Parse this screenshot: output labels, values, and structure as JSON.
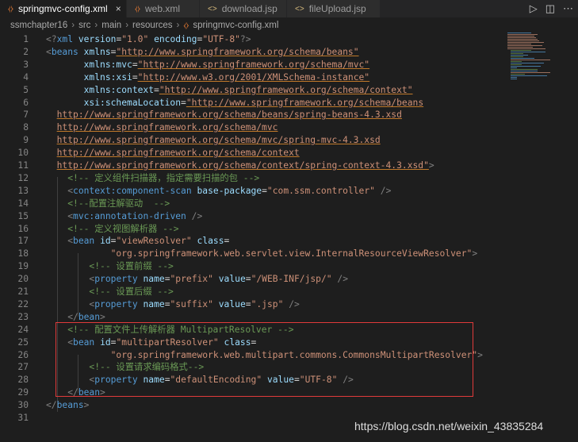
{
  "tabs": [
    {
      "label": "springmvc-config.xml",
      "active": true,
      "close": "×"
    },
    {
      "label": "web.xml",
      "active": false
    },
    {
      "label": "download.jsp",
      "active": false
    },
    {
      "label": "fileUpload.jsp",
      "active": false
    }
  ],
  "breadcrumb": [
    "ssmchapter16",
    "src",
    "main",
    "resources",
    "springmvc-config.xml"
  ],
  "actions": {
    "run": "▷",
    "split": "◫",
    "more": "⋯"
  },
  "lines": [
    {
      "n": "1",
      "segs": [
        [
          "pu",
          "<?"
        ],
        [
          "tg",
          "xml"
        ],
        [
          "tx",
          " "
        ],
        [
          "at",
          "version"
        ],
        [
          "tx",
          "="
        ],
        [
          "st",
          "\"1.0\""
        ],
        [
          "tx",
          " "
        ],
        [
          "at",
          "encoding"
        ],
        [
          "tx",
          "="
        ],
        [
          "st",
          "\"UTF-8\""
        ],
        [
          "pu",
          "?>"
        ]
      ]
    },
    {
      "n": "2",
      "segs": [
        [
          "pu",
          "<"
        ],
        [
          "tg",
          "beans"
        ],
        [
          "tx",
          " "
        ],
        [
          "at",
          "xmlns"
        ],
        [
          "tx",
          "="
        ],
        [
          "st",
          "\"http://www.springframework.org/schema/beans\""
        ]
      ]
    },
    {
      "n": "3",
      "segs": [
        [
          "tx",
          "       "
        ],
        [
          "at",
          "xmlns:mvc"
        ],
        [
          "tx",
          "="
        ],
        [
          "st",
          "\"http://www.springframework.org/schema/mvc\""
        ]
      ]
    },
    {
      "n": "4",
      "segs": [
        [
          "tx",
          "       "
        ],
        [
          "at",
          "xmlns:xsi"
        ],
        [
          "tx",
          "="
        ],
        [
          "st",
          "\"http://www.w3.org/2001/XMLSchema-instance\""
        ]
      ]
    },
    {
      "n": "5",
      "segs": [
        [
          "tx",
          "       "
        ],
        [
          "at",
          "xmlns:context"
        ],
        [
          "tx",
          "="
        ],
        [
          "st",
          "\"http://www.springframework.org/schema/context\""
        ]
      ]
    },
    {
      "n": "6",
      "segs": [
        [
          "tx",
          "       "
        ],
        [
          "at",
          "xsi:schemaLocation"
        ],
        [
          "tx",
          "="
        ],
        [
          "st",
          "\"http://www.springframework.org/schema/beans"
        ]
      ]
    },
    {
      "n": "7",
      "segs": [
        [
          "tx",
          "  "
        ],
        [
          "st",
          "http://www.springframework.org/schema/beans/spring-beans-4.3.xsd"
        ]
      ]
    },
    {
      "n": "8",
      "segs": [
        [
          "tx",
          "  "
        ],
        [
          "st",
          "http://www.springframework.org/schema/mvc"
        ]
      ]
    },
    {
      "n": "9",
      "segs": [
        [
          "tx",
          "  "
        ],
        [
          "st",
          "http://www.springframework.org/schema/mvc/spring-mvc-4.3.xsd"
        ]
      ]
    },
    {
      "n": "10",
      "segs": [
        [
          "tx",
          "  "
        ],
        [
          "st",
          "http://www.springframework.org/schema/context"
        ]
      ]
    },
    {
      "n": "11",
      "segs": [
        [
          "tx",
          "  "
        ],
        [
          "st",
          "http://www.springframework.org/schema/context/spring-context-4.3.xsd\""
        ],
        [
          "pu",
          ">"
        ]
      ]
    },
    {
      "n": "12",
      "segs": [
        [
          "tx",
          "    "
        ],
        [
          "cm",
          "<!-- 定义组件扫描器，指定需要扫描的包 -->"
        ]
      ]
    },
    {
      "n": "13",
      "segs": [
        [
          "tx",
          "    "
        ],
        [
          "pu",
          "<"
        ],
        [
          "tg",
          "context:component-scan"
        ],
        [
          "tx",
          " "
        ],
        [
          "at",
          "base-package"
        ],
        [
          "tx",
          "="
        ],
        [
          "st",
          "\"com.ssm.controller\""
        ],
        [
          "tx",
          " "
        ],
        [
          "pu",
          "/>"
        ]
      ]
    },
    {
      "n": "14",
      "segs": [
        [
          "tx",
          "    "
        ],
        [
          "cm",
          "<!--配置注解驱动  -->"
        ]
      ]
    },
    {
      "n": "15",
      "segs": [
        [
          "tx",
          "    "
        ],
        [
          "pu",
          "<"
        ],
        [
          "tg",
          "mvc:annotation-driven"
        ],
        [
          "tx",
          " "
        ],
        [
          "pu",
          "/>"
        ]
      ]
    },
    {
      "n": "16",
      "segs": [
        [
          "tx",
          "    "
        ],
        [
          "cm",
          "<!-- 定义视图解析器 -->"
        ]
      ]
    },
    {
      "n": "17",
      "segs": [
        [
          "tx",
          "    "
        ],
        [
          "pu",
          "<"
        ],
        [
          "tg",
          "bean"
        ],
        [
          "tx",
          " "
        ],
        [
          "at",
          "id"
        ],
        [
          "tx",
          "="
        ],
        [
          "st",
          "\"viewResolver\""
        ],
        [
          "tx",
          " "
        ],
        [
          "at",
          "class"
        ],
        [
          "tx",
          "="
        ]
      ]
    },
    {
      "n": "18",
      "segs": [
        [
          "tx",
          "            "
        ],
        [
          "st",
          "\"org.springframework.web.servlet.view.InternalResourceViewResolver\""
        ],
        [
          "pu",
          ">"
        ]
      ]
    },
    {
      "n": "19",
      "segs": [
        [
          "tx",
          "        "
        ],
        [
          "cm",
          "<!-- 设置前缀 -->"
        ]
      ]
    },
    {
      "n": "20",
      "segs": [
        [
          "tx",
          "        "
        ],
        [
          "pu",
          "<"
        ],
        [
          "tg",
          "property"
        ],
        [
          "tx",
          " "
        ],
        [
          "at",
          "name"
        ],
        [
          "tx",
          "="
        ],
        [
          "st",
          "\"prefix\""
        ],
        [
          "tx",
          " "
        ],
        [
          "at",
          "value"
        ],
        [
          "tx",
          "="
        ],
        [
          "st",
          "\"/WEB-INF/jsp/\""
        ],
        [
          "tx",
          " "
        ],
        [
          "pu",
          "/>"
        ]
      ]
    },
    {
      "n": "21",
      "segs": [
        [
          "tx",
          "        "
        ],
        [
          "cm",
          "<!-- 设置后缀 -->"
        ]
      ]
    },
    {
      "n": "22",
      "segs": [
        [
          "tx",
          "        "
        ],
        [
          "pu",
          "<"
        ],
        [
          "tg",
          "property"
        ],
        [
          "tx",
          " "
        ],
        [
          "at",
          "name"
        ],
        [
          "tx",
          "="
        ],
        [
          "st",
          "\"suffix\""
        ],
        [
          "tx",
          " "
        ],
        [
          "at",
          "value"
        ],
        [
          "tx",
          "="
        ],
        [
          "st",
          "\".jsp\""
        ],
        [
          "tx",
          " "
        ],
        [
          "pu",
          "/>"
        ]
      ]
    },
    {
      "n": "23",
      "segs": [
        [
          "tx",
          "    "
        ],
        [
          "pu",
          "</"
        ],
        [
          "tg",
          "bean"
        ],
        [
          "pu",
          ">"
        ]
      ]
    },
    {
      "n": "24",
      "segs": [
        [
          "tx",
          "    "
        ],
        [
          "cm",
          "<!-- 配置文件上传解析器 MultipartResolver -->"
        ]
      ]
    },
    {
      "n": "25",
      "segs": [
        [
          "tx",
          "    "
        ],
        [
          "pu",
          "<"
        ],
        [
          "tg",
          "bean"
        ],
        [
          "tx",
          " "
        ],
        [
          "at",
          "id"
        ],
        [
          "tx",
          "="
        ],
        [
          "st",
          "\"multipartResolver\""
        ],
        [
          "tx",
          " "
        ],
        [
          "at",
          "class"
        ],
        [
          "tx",
          "="
        ]
      ]
    },
    {
      "n": "26",
      "segs": [
        [
          "tx",
          "            "
        ],
        [
          "st",
          "\"org.springframework.web.multipart.commons.CommonsMultipartResolver\""
        ],
        [
          "pu",
          ">"
        ]
      ]
    },
    {
      "n": "27",
      "segs": [
        [
          "tx",
          "        "
        ],
        [
          "cm",
          "<!-- 设置请求编码格式-->"
        ]
      ]
    },
    {
      "n": "28",
      "segs": [
        [
          "tx",
          "        "
        ],
        [
          "pu",
          "<"
        ],
        [
          "tg",
          "property"
        ],
        [
          "tx",
          " "
        ],
        [
          "at",
          "name"
        ],
        [
          "tx",
          "="
        ],
        [
          "st",
          "\"defaultEncoding\""
        ],
        [
          "tx",
          " "
        ],
        [
          "at",
          "value"
        ],
        [
          "tx",
          "="
        ],
        [
          "st",
          "\"UTF-8\""
        ],
        [
          "tx",
          " "
        ],
        [
          "pu",
          "/>"
        ]
      ]
    },
    {
      "n": "29",
      "segs": [
        [
          "tx",
          "    "
        ],
        [
          "pu",
          "</"
        ],
        [
          "tg",
          "bean"
        ],
        [
          "pu",
          ">"
        ]
      ]
    },
    {
      "n": "30",
      "segs": [
        [
          "pu",
          "</"
        ],
        [
          "tg",
          "beans"
        ],
        [
          "pu",
          ">"
        ]
      ]
    },
    {
      "n": "31",
      "segs": []
    }
  ],
  "watermark": "https://blog.csdn.net/weixin_43835284"
}
